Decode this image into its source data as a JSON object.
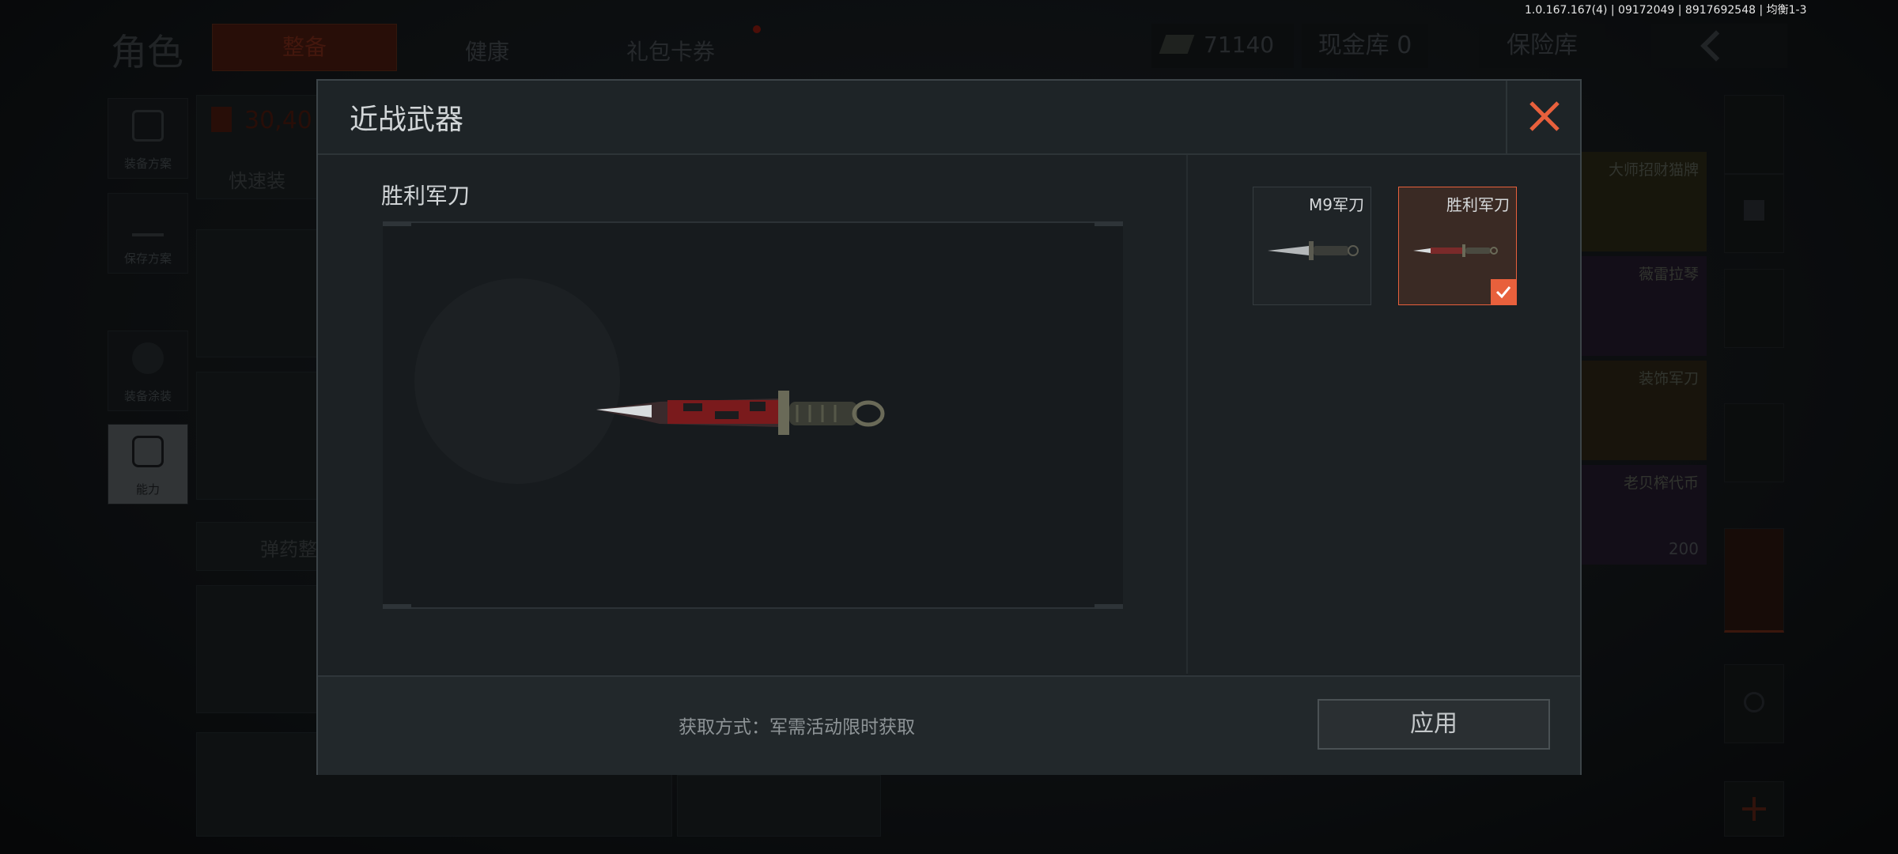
{
  "version": "1.0.167.167(4) | 09172049 | 8917692548 | 均衡1-3",
  "topbar": {
    "title": "角色",
    "tabs": [
      "整备",
      "健康",
      "礼包卡券"
    ],
    "currency_amount": "71140",
    "cash_vault": "现金库 0",
    "safe_box": "保险库"
  },
  "left_sidebar": {
    "items": [
      {
        "label": "装备方案",
        "icon": "backpack-icon"
      },
      {
        "label": "保存方案",
        "icon": "download-icon"
      },
      {
        "label": "装备涂装",
        "icon": "soldier-icon"
      },
      {
        "label": "能力",
        "icon": "lightning-hexagon-icon"
      }
    ]
  },
  "background": {
    "value_amount": "30,40",
    "quick_equip": "快速装",
    "ammo_sort": "弹药整"
  },
  "rewards": [
    {
      "label": "大师招财猫牌",
      "color": "#3a3418"
    },
    {
      "label": "薇雷拉琴",
      "color": "#2a1e33"
    },
    {
      "label": "装饰军刀",
      "color": "#3a3118"
    },
    {
      "label": "老贝榨代币",
      "color": "#2a1c33",
      "count": "200"
    }
  ],
  "modal": {
    "title": "近战武器",
    "selected_name": "胜利军刀",
    "items": [
      {
        "name": "M9军刀",
        "selected": false
      },
      {
        "name": "胜利军刀",
        "selected": true
      }
    ],
    "acquire_method": "获取方式：军需活动限时获取",
    "apply_label": "应用"
  },
  "colors": {
    "accent": "#e8603c",
    "selected_card_bg": "#3a2a24",
    "modal_bg": "#1b2023"
  }
}
